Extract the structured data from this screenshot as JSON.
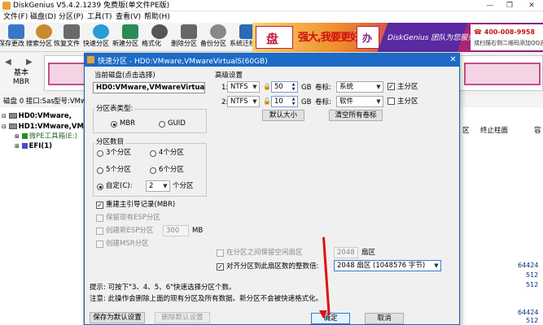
{
  "window": {
    "title": "DiskGenius V5.4.2.1239 免费版(单文件PE版)",
    "min": "—",
    "max": "❐",
    "close": "✕"
  },
  "menu": [
    "文件(F)",
    "磁盘(D)",
    "分区(P)",
    "工具(T)",
    "查看(V)",
    "帮助(H)"
  ],
  "toolbar": [
    {
      "label": "保存更改",
      "icon": "save-icon",
      "color": "#3a76c8"
    },
    {
      "label": "搜索分区",
      "icon": "search-icon",
      "color": "#c88a2a"
    },
    {
      "label": "恢复文件",
      "icon": "recover-icon",
      "color": "#6a6a6a"
    },
    {
      "label": "快速分区",
      "icon": "quick-partition-icon",
      "color": "#2a9ad8"
    },
    {
      "label": "新建分区",
      "icon": "new-partition-icon",
      "color": "#2a8a5a"
    },
    {
      "label": "格式化",
      "icon": "format-icon",
      "color": "#555555"
    },
    {
      "label": "删除分区",
      "icon": "delete-partition-icon",
      "color": "#666666"
    },
    {
      "label": "备份分区",
      "icon": "backup-partition-icon",
      "color": "#888888"
    },
    {
      "label": "系统迁移",
      "icon": "migrate-icon",
      "color": "#2a68b8"
    }
  ],
  "banner": {
    "slogan": "强大,我要更好",
    "service": "DiskGenius 团队为您服务",
    "hotline": "400-008-9958",
    "qq": "或扫描右侧二维码添加QQ咨询",
    "logo": "盘",
    "logo2": "办"
  },
  "disk_panel": {
    "basic": "基本",
    "mbr": "MBR",
    "prev": "◀",
    "next": "▶"
  },
  "disk_line": {
    "disk": "磁盘 0 接口:Sas",
    "model": "型号:VMw"
  },
  "tree": {
    "disk0": "HD0:VMware,",
    "disk1": "HD1:VMware,VM",
    "part1": "微PE工具箱(E:)",
    "part2": "EFI(1)"
  },
  "right_table": {
    "col1": "区",
    "col2": "终止柱面",
    "col3": "容",
    "nums": [
      "64424",
      "512",
      "512",
      "64424",
      "512"
    ]
  },
  "dialog": {
    "title": "快速分区 - HD0:VMware,VMwareVirtualS(60GB)",
    "close": "✕",
    "current_disk_label": "当前磁盘(点击选择)",
    "current_disk": "HD0:VMware,VMwareVirtualS(",
    "table_type_title": "分区表类型:",
    "mbr": "MBR",
    "guid": "GUID",
    "count_title": "分区数目",
    "count_options": [
      "3个分区",
      "4个分区",
      "5个分区",
      "6个分区"
    ],
    "custom_label": "自定(C):",
    "custom_value": "2",
    "custom_unit": "个分区",
    "rebuild_mbr": "重建主引导记录(MBR)",
    "keep_esp": "保留现有ESP分区",
    "create_esp": "创建新ESP分区",
    "esp_size": "300",
    "esp_unit": "MB",
    "create_msr": "创建MSR分区",
    "advanced_title": "高级设置",
    "rows": [
      {
        "index": "1:",
        "fs": "NTFS",
        "size": "50",
        "unit": "GB",
        "label_text": "卷标:",
        "label": "系统",
        "primary": "主分区",
        "primary_checked": "✓"
      },
      {
        "index": "2:",
        "fs": "NTFS",
        "size": "10",
        "unit": "GB",
        "label_text": "卷标:",
        "label": "软件",
        "primary": "主分区",
        "primary_checked": ""
      }
    ],
    "default_size": "默认大小",
    "clear_labels": "清空所有卷标",
    "free_space": "在分区之间保留空闲扇区",
    "free_value": "2048",
    "free_unit": "扇区",
    "align": "对齐分区到此扇区数的整数倍:",
    "align_value": "2048 扇区 (1048576 字节)",
    "hint1": "提示: 可按下\"3、4、5、6\"快速选择分区个数。",
    "hint2": "注意: 此操作会删除上面的现有分区及所有数据。新分区不会被快速格式化。",
    "save_default": "保存为默认设置",
    "delete_default": "删除默认设置",
    "ok": "确定",
    "cancel": "取消"
  }
}
